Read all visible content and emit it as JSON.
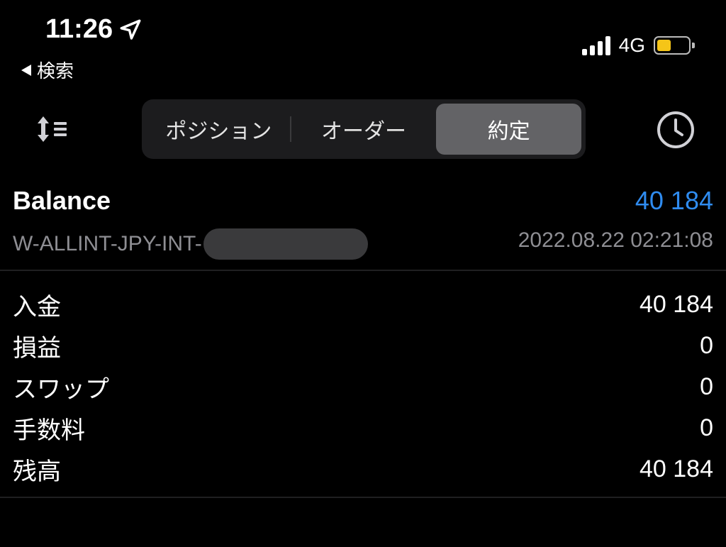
{
  "status_bar": {
    "time": "11:26",
    "back_label": "検索",
    "network": "4G",
    "battery_level": 0.45
  },
  "tabs": [
    {
      "label": "ポジション",
      "active": false
    },
    {
      "label": "オーダー",
      "active": false
    },
    {
      "label": "約定",
      "active": true
    }
  ],
  "balance": {
    "title": "Balance",
    "amount": "40 184",
    "account": "W-ALLINT-JPY-INT-",
    "datetime": "2022.08.22 02:21:08"
  },
  "details": [
    {
      "label": "入金",
      "value": "40 184"
    },
    {
      "label": "損益",
      "value": "0"
    },
    {
      "label": "スワップ",
      "value": "0"
    },
    {
      "label": "手数料",
      "value": "0"
    },
    {
      "label": "残高",
      "value": "40 184"
    }
  ],
  "colors": {
    "background": "#000000",
    "accent": "#2f8cf0",
    "secondary_text": "#8e8e93",
    "battery": "#f5c518"
  },
  "icons": {
    "location": "location-arrow-icon",
    "back": "back-triangle-icon",
    "signal": "cellular-signal-icon",
    "battery": "battery-icon",
    "sort": "sort-icon",
    "history": "clock-icon"
  }
}
